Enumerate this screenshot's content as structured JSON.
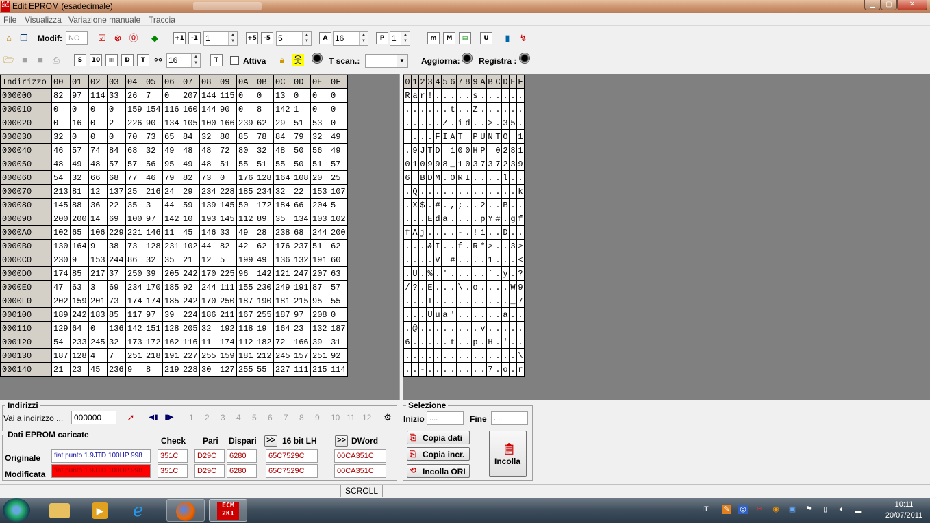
{
  "window": {
    "title": "Edit EPROM (esadecimale)",
    "app_icon_text": "ECM 2K1"
  },
  "menu": [
    "File",
    "Visualizza",
    "Variazione manuale",
    "Traccia"
  ],
  "toolbar1": {
    "modif_label": "Modif:",
    "modif_value": "NO",
    "spin1": "1",
    "spin2": "5",
    "spin3": "16",
    "spin4": "1"
  },
  "toolbar2": {
    "spin": "16",
    "attiva_label": "Attiva",
    "tscan_label": "T scan.:",
    "aggiorna_label": "Aggiorna:",
    "registra_label": "Registra :"
  },
  "hex": {
    "address_header": "Indirizzo",
    "columns": [
      "00",
      "01",
      "02",
      "03",
      "04",
      "05",
      "06",
      "07",
      "08",
      "09",
      "0A",
      "0B",
      "0C",
      "0D",
      "0E",
      "0F"
    ],
    "rows": [
      {
        "addr": "000000",
        "cells": [
          "82",
          "97",
          "114",
          "33",
          "26",
          "7",
          "0",
          "207",
          "144",
          "115",
          "0",
          "0",
          "13",
          "0",
          "0",
          "0"
        ]
      },
      {
        "addr": "000010",
        "cells": [
          "0",
          "0",
          "0",
          "0",
          "159",
          "154",
          "116",
          "160",
          "144",
          "90",
          "0",
          "8",
          "142",
          "1",
          "0",
          "0"
        ]
      },
      {
        "addr": "000020",
        "cells": [
          "0",
          "16",
          "0",
          "2",
          "226",
          "90",
          "134",
          "105",
          "100",
          "166",
          "239",
          "62",
          "29",
          "51",
          "53",
          "0"
        ]
      },
      {
        "addr": "000030",
        "cells": [
          "32",
          "0",
          "0",
          "0",
          "70",
          "73",
          "65",
          "84",
          "32",
          "80",
          "85",
          "78",
          "84",
          "79",
          "32",
          "49"
        ]
      },
      {
        "addr": "000040",
        "cells": [
          "46",
          "57",
          "74",
          "84",
          "68",
          "32",
          "49",
          "48",
          "48",
          "72",
          "80",
          "32",
          "48",
          "50",
          "56",
          "49"
        ]
      },
      {
        "addr": "000050",
        "cells": [
          "48",
          "49",
          "48",
          "57",
          "57",
          "56",
          "95",
          "49",
          "48",
          "51",
          "55",
          "51",
          "55",
          "50",
          "51",
          "57"
        ]
      },
      {
        "addr": "000060",
        "cells": [
          "54",
          "32",
          "66",
          "68",
          "77",
          "46",
          "79",
          "82",
          "73",
          "0",
          "176",
          "128",
          "164",
          "108",
          "20",
          "25"
        ]
      },
      {
        "addr": "000070",
        "cells": [
          "213",
          "81",
          "12",
          "137",
          "25",
          "216",
          "24",
          "29",
          "234",
          "228",
          "185",
          "234",
          "32",
          "22",
          "153",
          "107"
        ]
      },
      {
        "addr": "000080",
        "cells": [
          "145",
          "88",
          "36",
          "22",
          "35",
          "3",
          "44",
          "59",
          "139",
          "145",
          "50",
          "172",
          "184",
          "66",
          "204",
          "5"
        ]
      },
      {
        "addr": "000090",
        "cells": [
          "200",
          "200",
          "14",
          "69",
          "100",
          "97",
          "142",
          "10",
          "193",
          "145",
          "112",
          "89",
          "35",
          "134",
          "103",
          "102"
        ]
      },
      {
        "addr": "0000A0",
        "cells": [
          "102",
          "65",
          "106",
          "229",
          "221",
          "146",
          "11",
          "45",
          "146",
          "33",
          "49",
          "28",
          "238",
          "68",
          "244",
          "200"
        ]
      },
      {
        "addr": "0000B0",
        "cells": [
          "130",
          "164",
          "9",
          "38",
          "73",
          "128",
          "231",
          "102",
          "44",
          "82",
          "42",
          "62",
          "176",
          "237",
          "51",
          "62"
        ]
      },
      {
        "addr": "0000C0",
        "cells": [
          "230",
          "9",
          "153",
          "244",
          "86",
          "32",
          "35",
          "21",
          "12",
          "5",
          "199",
          "49",
          "136",
          "132",
          "191",
          "60"
        ]
      },
      {
        "addr": "0000D0",
        "cells": [
          "174",
          "85",
          "217",
          "37",
          "250",
          "39",
          "205",
          "242",
          "170",
          "225",
          "96",
          "142",
          "121",
          "247",
          "207",
          "63"
        ]
      },
      {
        "addr": "0000E0",
        "cells": [
          "47",
          "63",
          "3",
          "69",
          "234",
          "170",
          "185",
          "92",
          "244",
          "111",
          "155",
          "230",
          "249",
          "191",
          "87",
          "57"
        ]
      },
      {
        "addr": "0000F0",
        "cells": [
          "202",
          "159",
          "201",
          "73",
          "174",
          "174",
          "185",
          "242",
          "170",
          "250",
          "187",
          "190",
          "181",
          "215",
          "95",
          "55"
        ]
      },
      {
        "addr": "000100",
        "cells": [
          "189",
          "242",
          "183",
          "85",
          "117",
          "97",
          "39",
          "224",
          "186",
          "211",
          "167",
          "255",
          "187",
          "97",
          "208",
          "0"
        ]
      },
      {
        "addr": "000110",
        "cells": [
          "129",
          "64",
          "0",
          "136",
          "142",
          "151",
          "128",
          "205",
          "32",
          "192",
          "118",
          "19",
          "164",
          "23",
          "132",
          "187"
        ]
      },
      {
        "addr": "000120",
        "cells": [
          "54",
          "233",
          "245",
          "32",
          "173",
          "172",
          "162",
          "116",
          "11",
          "174",
          "112",
          "182",
          "72",
          "166",
          "39",
          "31"
        ]
      },
      {
        "addr": "000130",
        "cells": [
          "187",
          "128",
          "4",
          "7",
          "251",
          "218",
          "191",
          "227",
          "255",
          "159",
          "181",
          "212",
          "245",
          "157",
          "251",
          "92"
        ]
      },
      {
        "addr": "000140",
        "cells": [
          "21",
          "23",
          "45",
          "236",
          "9",
          "8",
          "219",
          "228",
          "30",
          "127",
          "255",
          "55",
          "227",
          "111",
          "215",
          "114"
        ]
      }
    ]
  },
  "ascii": {
    "columns": [
      "0",
      "1",
      "2",
      "3",
      "4",
      "5",
      "6",
      "7",
      "8",
      "9",
      "A",
      "B",
      "C",
      "D",
      "E",
      "F"
    ],
    "rows": [
      [
        "R",
        "a",
        "r",
        "!",
        ".",
        ".",
        ".",
        ".",
        ".",
        "s",
        ".",
        ".",
        ".",
        ".",
        ".",
        "."
      ],
      [
        ".",
        ".",
        ".",
        ".",
        ".",
        ".",
        "t",
        ".",
        ".",
        "Z",
        ".",
        ".",
        ".",
        ".",
        ".",
        "."
      ],
      [
        ".",
        ".",
        ".",
        ".",
        ".",
        "Z",
        ".",
        "i",
        "d",
        ".",
        ".",
        ">",
        ".",
        "3",
        "5",
        "."
      ],
      [
        " ",
        ".",
        ".",
        ".",
        "F",
        "I",
        "A",
        "T",
        " ",
        "P",
        "U",
        "N",
        "T",
        "O",
        " ",
        "1"
      ],
      [
        ".",
        "9",
        "J",
        "T",
        "D",
        " ",
        "1",
        "0",
        "0",
        "H",
        "P",
        " ",
        "0",
        "2",
        "8",
        "1"
      ],
      [
        "0",
        "1",
        "0",
        "9",
        "9",
        "8",
        "_",
        "1",
        "0",
        "3",
        "7",
        "3",
        "7",
        "2",
        "3",
        "9"
      ],
      [
        "6",
        " ",
        "B",
        "D",
        "M",
        ".",
        "O",
        "R",
        "I",
        ".",
        ".",
        ".",
        ".",
        "l",
        ".",
        "."
      ],
      [
        ".",
        "Q",
        ".",
        ".",
        ".",
        ".",
        ".",
        ".",
        ".",
        ".",
        ".",
        ".",
        ".",
        ".",
        ".",
        "k"
      ],
      [
        ".",
        "X",
        "$",
        ".",
        "#",
        ".",
        ",",
        ";",
        ".",
        ".",
        "2",
        ".",
        ".",
        "B",
        ".",
        "."
      ],
      [
        ".",
        ".",
        ".",
        "E",
        "d",
        "a",
        ".",
        ".",
        ".",
        ".",
        "p",
        "Y",
        "#",
        ".",
        "g",
        "f"
      ],
      [
        "f",
        "A",
        "j",
        ".",
        ".",
        ".",
        ".",
        "-",
        ".",
        "!",
        "1",
        ".",
        ".",
        "D",
        ".",
        "."
      ],
      [
        ".",
        ".",
        ".",
        "&",
        "I",
        ".",
        ".",
        "f",
        ".",
        "R",
        "*",
        ">",
        ".",
        ".",
        "3",
        ">"
      ],
      [
        ".",
        ".",
        ".",
        ".",
        "V",
        " ",
        "#",
        ".",
        ".",
        ".",
        ".",
        "1",
        ".",
        ".",
        ".",
        "<"
      ],
      [
        ".",
        "U",
        ".",
        "%",
        ".",
        "'",
        ".",
        ".",
        ".",
        ".",
        ".",
        "`",
        ".",
        "y",
        ".",
        "?"
      ],
      [
        "/",
        "?",
        ".",
        "E",
        ".",
        ".",
        ".",
        "\\",
        ".",
        "o",
        ".",
        ".",
        ".",
        ".",
        "W",
        "9"
      ],
      [
        ".",
        ".",
        ".",
        "I",
        ".",
        ".",
        ".",
        ".",
        ".",
        ".",
        ".",
        ".",
        ".",
        ".",
        "_",
        "7"
      ],
      [
        ".",
        ".",
        ".",
        "U",
        "u",
        "a",
        "'",
        ".",
        ".",
        ".",
        ".",
        ".",
        ".",
        "a",
        ".",
        "."
      ],
      [
        ".",
        "@",
        ".",
        ".",
        ".",
        ".",
        ".",
        ".",
        ".",
        ".",
        "v",
        ".",
        ".",
        ".",
        ".",
        "."
      ],
      [
        "6",
        ".",
        ".",
        ".",
        ".",
        ".",
        "t",
        ".",
        ".",
        "p",
        ".",
        "H",
        ".",
        "'",
        ".",
        "."
      ],
      [
        ".",
        ".",
        ".",
        ".",
        ".",
        ".",
        ".",
        ".",
        ".",
        ".",
        ".",
        ".",
        ".",
        ".",
        ".",
        "\\"
      ],
      [
        ".",
        ".",
        "-",
        ".",
        ".",
        ".",
        ".",
        ".",
        ".",
        ".",
        ".",
        "7",
        ".",
        "o",
        ".",
        "r"
      ]
    ]
  },
  "addresses": {
    "title": "Indirizzi",
    "goto_label": "Vai a indirizzo ...",
    "goto_value": "000000",
    "bookmarks": [
      "1",
      "2",
      "3",
      "4",
      "5",
      "6",
      "7",
      "8",
      "9",
      "10",
      "11",
      "12"
    ]
  },
  "eprom": {
    "title": "Dati EPROM caricate",
    "headers": {
      "check": "Check",
      "pari": "Pari",
      "dispari": "Dispari",
      "lh_btn": ">>",
      "lh": "16 bit LH",
      "dw_btn": ">>",
      "dword": "DWord"
    },
    "originale": {
      "label": "Originale",
      "name": "fiat punto 1.9JTD 100HP 998",
      "check": "351C",
      "pari": "D29C",
      "dispari": "6280",
      "lh": "65C7529C",
      "dword": "00CA351C"
    },
    "modificata": {
      "label": "Modificata",
      "name": "fiat punto 1.9JTD 100HP 998",
      "check": "351C",
      "pari": "D29C",
      "dispari": "6280",
      "lh": "65C7529C",
      "dword": "00CA351C"
    }
  },
  "selection": {
    "title": "Selezione",
    "inizio_label": "Inizio",
    "inizio_value": "....",
    "fine_label": "Fine",
    "fine_value": "....",
    "copia_dati": "Copia dati",
    "copia_incr": "Copia incr.",
    "incolla_ori": "Incolla ORI",
    "incolla": "Incolla"
  },
  "status": {
    "scroll": "SCROLL"
  },
  "taskbar": {
    "lang": "IT",
    "time": "10:11",
    "date": "20/07/2011"
  }
}
